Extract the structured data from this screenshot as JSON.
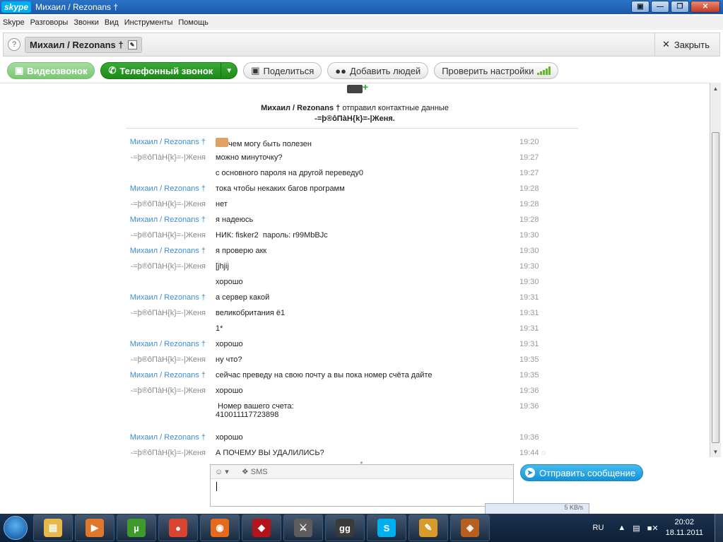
{
  "window": {
    "logo": "skype",
    "title": "Михаил  / Rezonans †",
    "controls": [
      "restore",
      "minimize",
      "maximize",
      "close"
    ]
  },
  "menu": [
    "Skype",
    "Разговоры",
    "Звонки",
    "Вид",
    "Инструменты",
    "Помощь"
  ],
  "header": {
    "contact_name": "Михаил  / Rezonans †",
    "close_label": "Закрыть"
  },
  "toolbar": {
    "video_call": "Видеозвонок",
    "phone_call": "Телефонный звонок",
    "share": "Поделиться",
    "add_people": "Добавить людей",
    "check_settings": "Проверить настройки"
  },
  "contact_card": {
    "sender": "Михаил  / Rezonans †",
    "action": "отправил контактные данные",
    "contact": "-=þ®ôΠàH{k}=-|Женя."
  },
  "messages": [
    {
      "sender": "Михаил  / Rezonans †",
      "me": true,
      "text": "чем могу быть полезен",
      "time": "19:20",
      "emoticon": true
    },
    {
      "sender": "-=þ®ôΠàH{k}=-|Женя",
      "me": false,
      "text": "можно минуточку?",
      "time": "19:27"
    },
    {
      "sender": "",
      "me": false,
      "text": "с основного пароля на другой переведу0",
      "time": "19:27"
    },
    {
      "sender": "Михаил  / Rezonans †",
      "me": true,
      "text": "тока чтобы некаких багов программ",
      "time": "19:28"
    },
    {
      "sender": "-=þ®ôΠàH{k}=-|Женя",
      "me": false,
      "text": "нет",
      "time": "19:28"
    },
    {
      "sender": "Михаил  / Rezonans †",
      "me": true,
      "text": "я надеюсь",
      "time": "19:28"
    },
    {
      "sender": "-=þ®ôΠàH{k}=-|Женя",
      "me": false,
      "text": "НИК: fisker2  пароль: r99MbBJc",
      "time": "19:30"
    },
    {
      "sender": "Михаил  / Rezonans †",
      "me": true,
      "text": "я проверю акк",
      "time": "19:30"
    },
    {
      "sender": "-=þ®ôΠàH{k}=-|Женя",
      "me": false,
      "text": "[jhjij",
      "time": "19:30"
    },
    {
      "sender": "",
      "me": false,
      "text": "хорошо",
      "time": "19:30"
    },
    {
      "sender": "Михаил  / Rezonans †",
      "me": true,
      "text": "а сервер какой",
      "time": "19:31"
    },
    {
      "sender": "-=þ®ôΠàH{k}=-|Женя",
      "me": false,
      "text": "великобритания ё1",
      "time": "19:31"
    },
    {
      "sender": "",
      "me": false,
      "text": "1*",
      "time": "19:31"
    },
    {
      "sender": "Михаил  / Rezonans †",
      "me": true,
      "text": "хорошо",
      "time": "19:31"
    },
    {
      "sender": "-=þ®ôΠàH{k}=-|Женя",
      "me": false,
      "text": "ну что?",
      "time": "19:35"
    },
    {
      "sender": "Михаил  / Rezonans †",
      "me": true,
      "text": "сейчас преведу на свою почту а вы пока номер счёта дайте",
      "time": "19:35"
    },
    {
      "sender": "-=þ®ôΠàH{k}=-|Женя",
      "me": false,
      "text": "хорошо",
      "time": "19:36"
    },
    {
      "sender": "",
      "me": false,
      "text": " Номер вашего счета:\n410011117723898",
      "time": "19:36"
    },
    {
      "sender": "Михаил  / Rezonans †",
      "me": true,
      "text": "хорошо",
      "time": "19:36"
    },
    {
      "sender": "-=þ®ôΠàH{k}=-|Женя",
      "me": false,
      "text": "А ПОЧЕМУ ВЫ УДАЛИЛИСЬ?",
      "time": "19:44",
      "pending": true
    }
  ],
  "composer": {
    "sms_label": "SMS",
    "send_label": "Отправить сообщение"
  },
  "popup_text": "5 KB/s",
  "taskbar": {
    "apps": [
      {
        "name": "explorer-icon",
        "color": "#e8b84a",
        "glyph": "▤"
      },
      {
        "name": "media-player-icon",
        "color": "#e0772b",
        "glyph": "▶"
      },
      {
        "name": "utorrent-icon",
        "color": "#3d9a2b",
        "glyph": "µ"
      },
      {
        "name": "chrome-icon",
        "color": "#d9442f",
        "glyph": "●"
      },
      {
        "name": "firefox-icon",
        "color": "#e66a1e",
        "glyph": "◉"
      },
      {
        "name": "game-icon",
        "color": "#b3141b",
        "glyph": "◆"
      },
      {
        "name": "crossed-swords-icon",
        "color": "#5d5d5d",
        "glyph": "⚔"
      },
      {
        "name": "gadu-gadu-icon",
        "color": "#3a3a3a",
        "glyph": "gg"
      },
      {
        "name": "skype-icon",
        "color": "#00aff0",
        "glyph": "S"
      },
      {
        "name": "paint-icon",
        "color": "#d89a2a",
        "glyph": "✎"
      },
      {
        "name": "download-manager-icon",
        "color": "#b75f1e",
        "glyph": "◈"
      }
    ],
    "lang": "RU",
    "time": "20:02",
    "date": "18.11.2011"
  }
}
